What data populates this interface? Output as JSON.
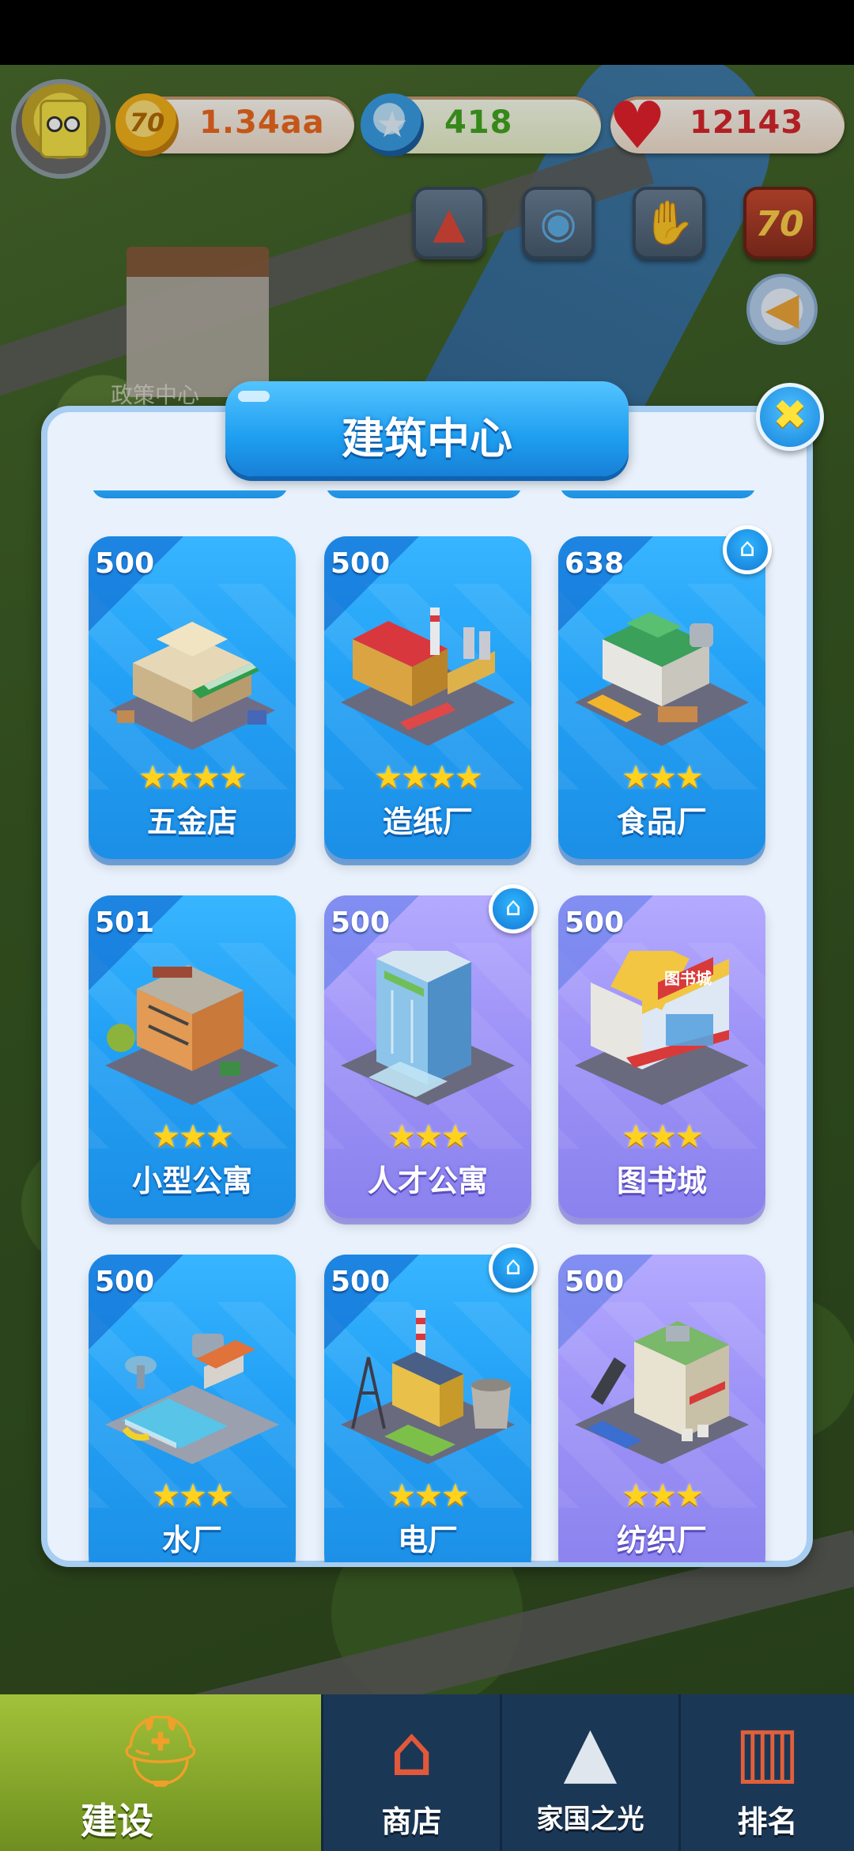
{
  "hud": {
    "coins": "1.34aa",
    "gems": "418",
    "hearts": "12143",
    "coin_badge": "70",
    "event_badge": "70"
  },
  "background": {
    "building_label": "政策中心"
  },
  "panel": {
    "title": "建筑中心",
    "cards": [
      {
        "name": "五金店",
        "price": "500",
        "stars": "★★★★",
        "theme": "blue",
        "home": false
      },
      {
        "name": "造纸厂",
        "price": "500",
        "stars": "★★★★",
        "theme": "blue",
        "home": false
      },
      {
        "name": "食品厂",
        "price": "638",
        "stars": "★★★",
        "theme": "blue",
        "home": true
      },
      {
        "name": "小型公寓",
        "price": "501",
        "stars": "★★★",
        "theme": "blue",
        "home": false
      },
      {
        "name": "人才公寓",
        "price": "500",
        "stars": "★★★",
        "theme": "purple",
        "home": true
      },
      {
        "name": "图书城",
        "price": "500",
        "stars": "★★★",
        "theme": "purple",
        "home": false
      },
      {
        "name": "水厂",
        "price": "500",
        "stars": "★★★",
        "theme": "blue",
        "home": false
      },
      {
        "name": "电厂",
        "price": "500",
        "stars": "★★★",
        "theme": "blue",
        "home": true
      },
      {
        "name": "纺织厂",
        "price": "500",
        "stars": "★★★",
        "theme": "purple",
        "home": false
      }
    ],
    "library_sign": "图书城"
  },
  "bottom_nav": [
    {
      "label": "建设",
      "icon": "hardhat-icon",
      "active": true
    },
    {
      "label": "商店",
      "icon": "shop-icon",
      "active": false
    },
    {
      "label": "家国之光",
      "icon": "rocket-icon",
      "active": false
    },
    {
      "label": "排名",
      "icon": "ranking-icon",
      "active": false
    }
  ],
  "colors": {
    "card_blue": "#22a0f5",
    "card_purple": "#9d92f7",
    "star": "#ffd21e",
    "coin_text": "#f06a1f",
    "gem_text": "#43a620",
    "heart_text": "#d8262c"
  }
}
